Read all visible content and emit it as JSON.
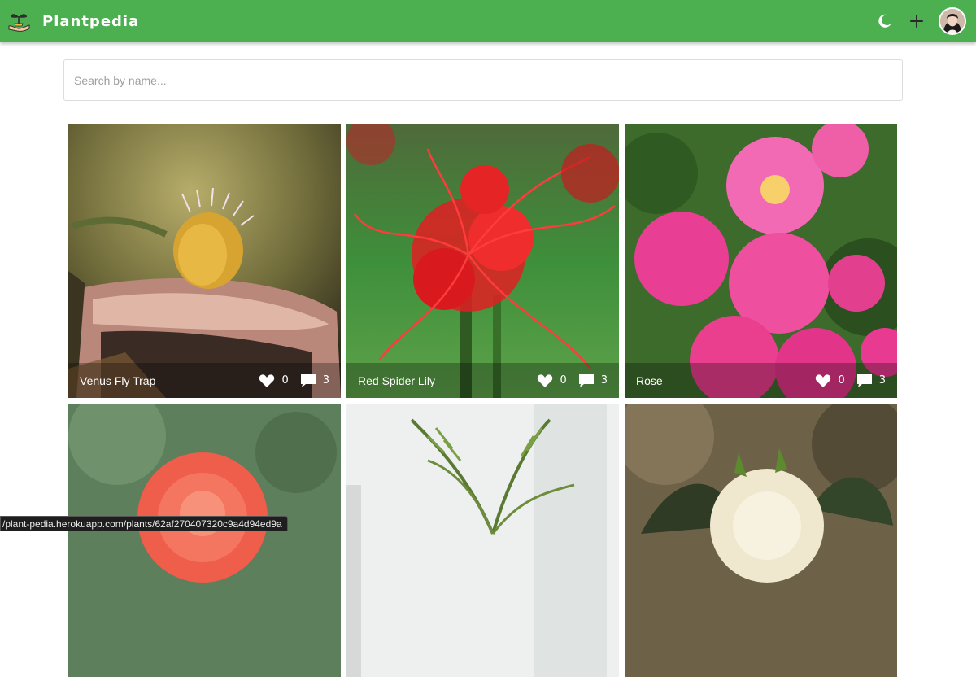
{
  "app": {
    "title": "Plantpedia"
  },
  "search": {
    "placeholder": "Search by name..."
  },
  "plants": [
    {
      "name": "Venus Fly Trap",
      "likes": "0",
      "comments": "3"
    },
    {
      "name": "Red Spider Lily",
      "likes": "0",
      "comments": "3"
    },
    {
      "name": "Rose",
      "likes": "0",
      "comments": "3"
    },
    {
      "name": "",
      "likes": "",
      "comments": ""
    },
    {
      "name": "",
      "likes": "",
      "comments": ""
    },
    {
      "name": "",
      "likes": "",
      "comments": ""
    }
  ],
  "status_url": "/plant-pedia.herokuapp.com/plants/62af270407320c9a4d94ed9a",
  "colors": {
    "navbar": "#4caf50",
    "card_bar": "rgba(0,0,0,0.28)"
  },
  "icons": {
    "logo": "plant-hand-icon",
    "theme": "moon-icon",
    "add": "plus-icon",
    "like": "heart-icon",
    "comment": "comment-icon"
  }
}
